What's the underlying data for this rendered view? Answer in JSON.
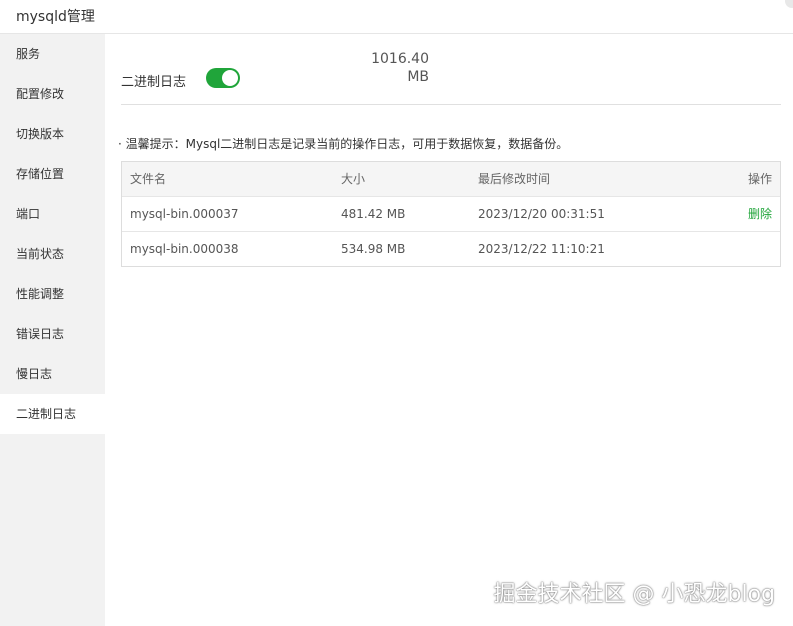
{
  "window": {
    "title": "mysqld管理"
  },
  "sidebar": {
    "items": [
      {
        "label": "服务"
      },
      {
        "label": "配置修改"
      },
      {
        "label": "切换版本"
      },
      {
        "label": "存储位置"
      },
      {
        "label": "端口"
      },
      {
        "label": "当前状态"
      },
      {
        "label": "性能调整"
      },
      {
        "label": "错误日志"
      },
      {
        "label": "慢日志"
      },
      {
        "label": "二进制日志"
      }
    ],
    "active_index": 9
  },
  "binlog": {
    "total_size_value": "1016.40",
    "total_size_unit": "MB",
    "toggle_label": "二进制日志",
    "toggle_on": true,
    "tip": "· 温馨提示：Mysql二进制日志是记录当前的操作日志，可用于数据恢复，数据备份。"
  },
  "table": {
    "headers": [
      "文件名",
      "大小",
      "最后修改时间",
      "操作"
    ],
    "rows": [
      {
        "name": "mysql-bin.000037",
        "size": "481.42 MB",
        "mtime": "2023/12/20 00:31:51",
        "action": "删除"
      },
      {
        "name": "mysql-bin.000038",
        "size": "534.98 MB",
        "mtime": "2023/12/22 11:10:21",
        "action": ""
      }
    ]
  },
  "watermark": "掘金技术社区 @ 小恐龙blog",
  "colors": {
    "accent": "#20a53a",
    "sidebar_bg": "#f2f2f2"
  }
}
